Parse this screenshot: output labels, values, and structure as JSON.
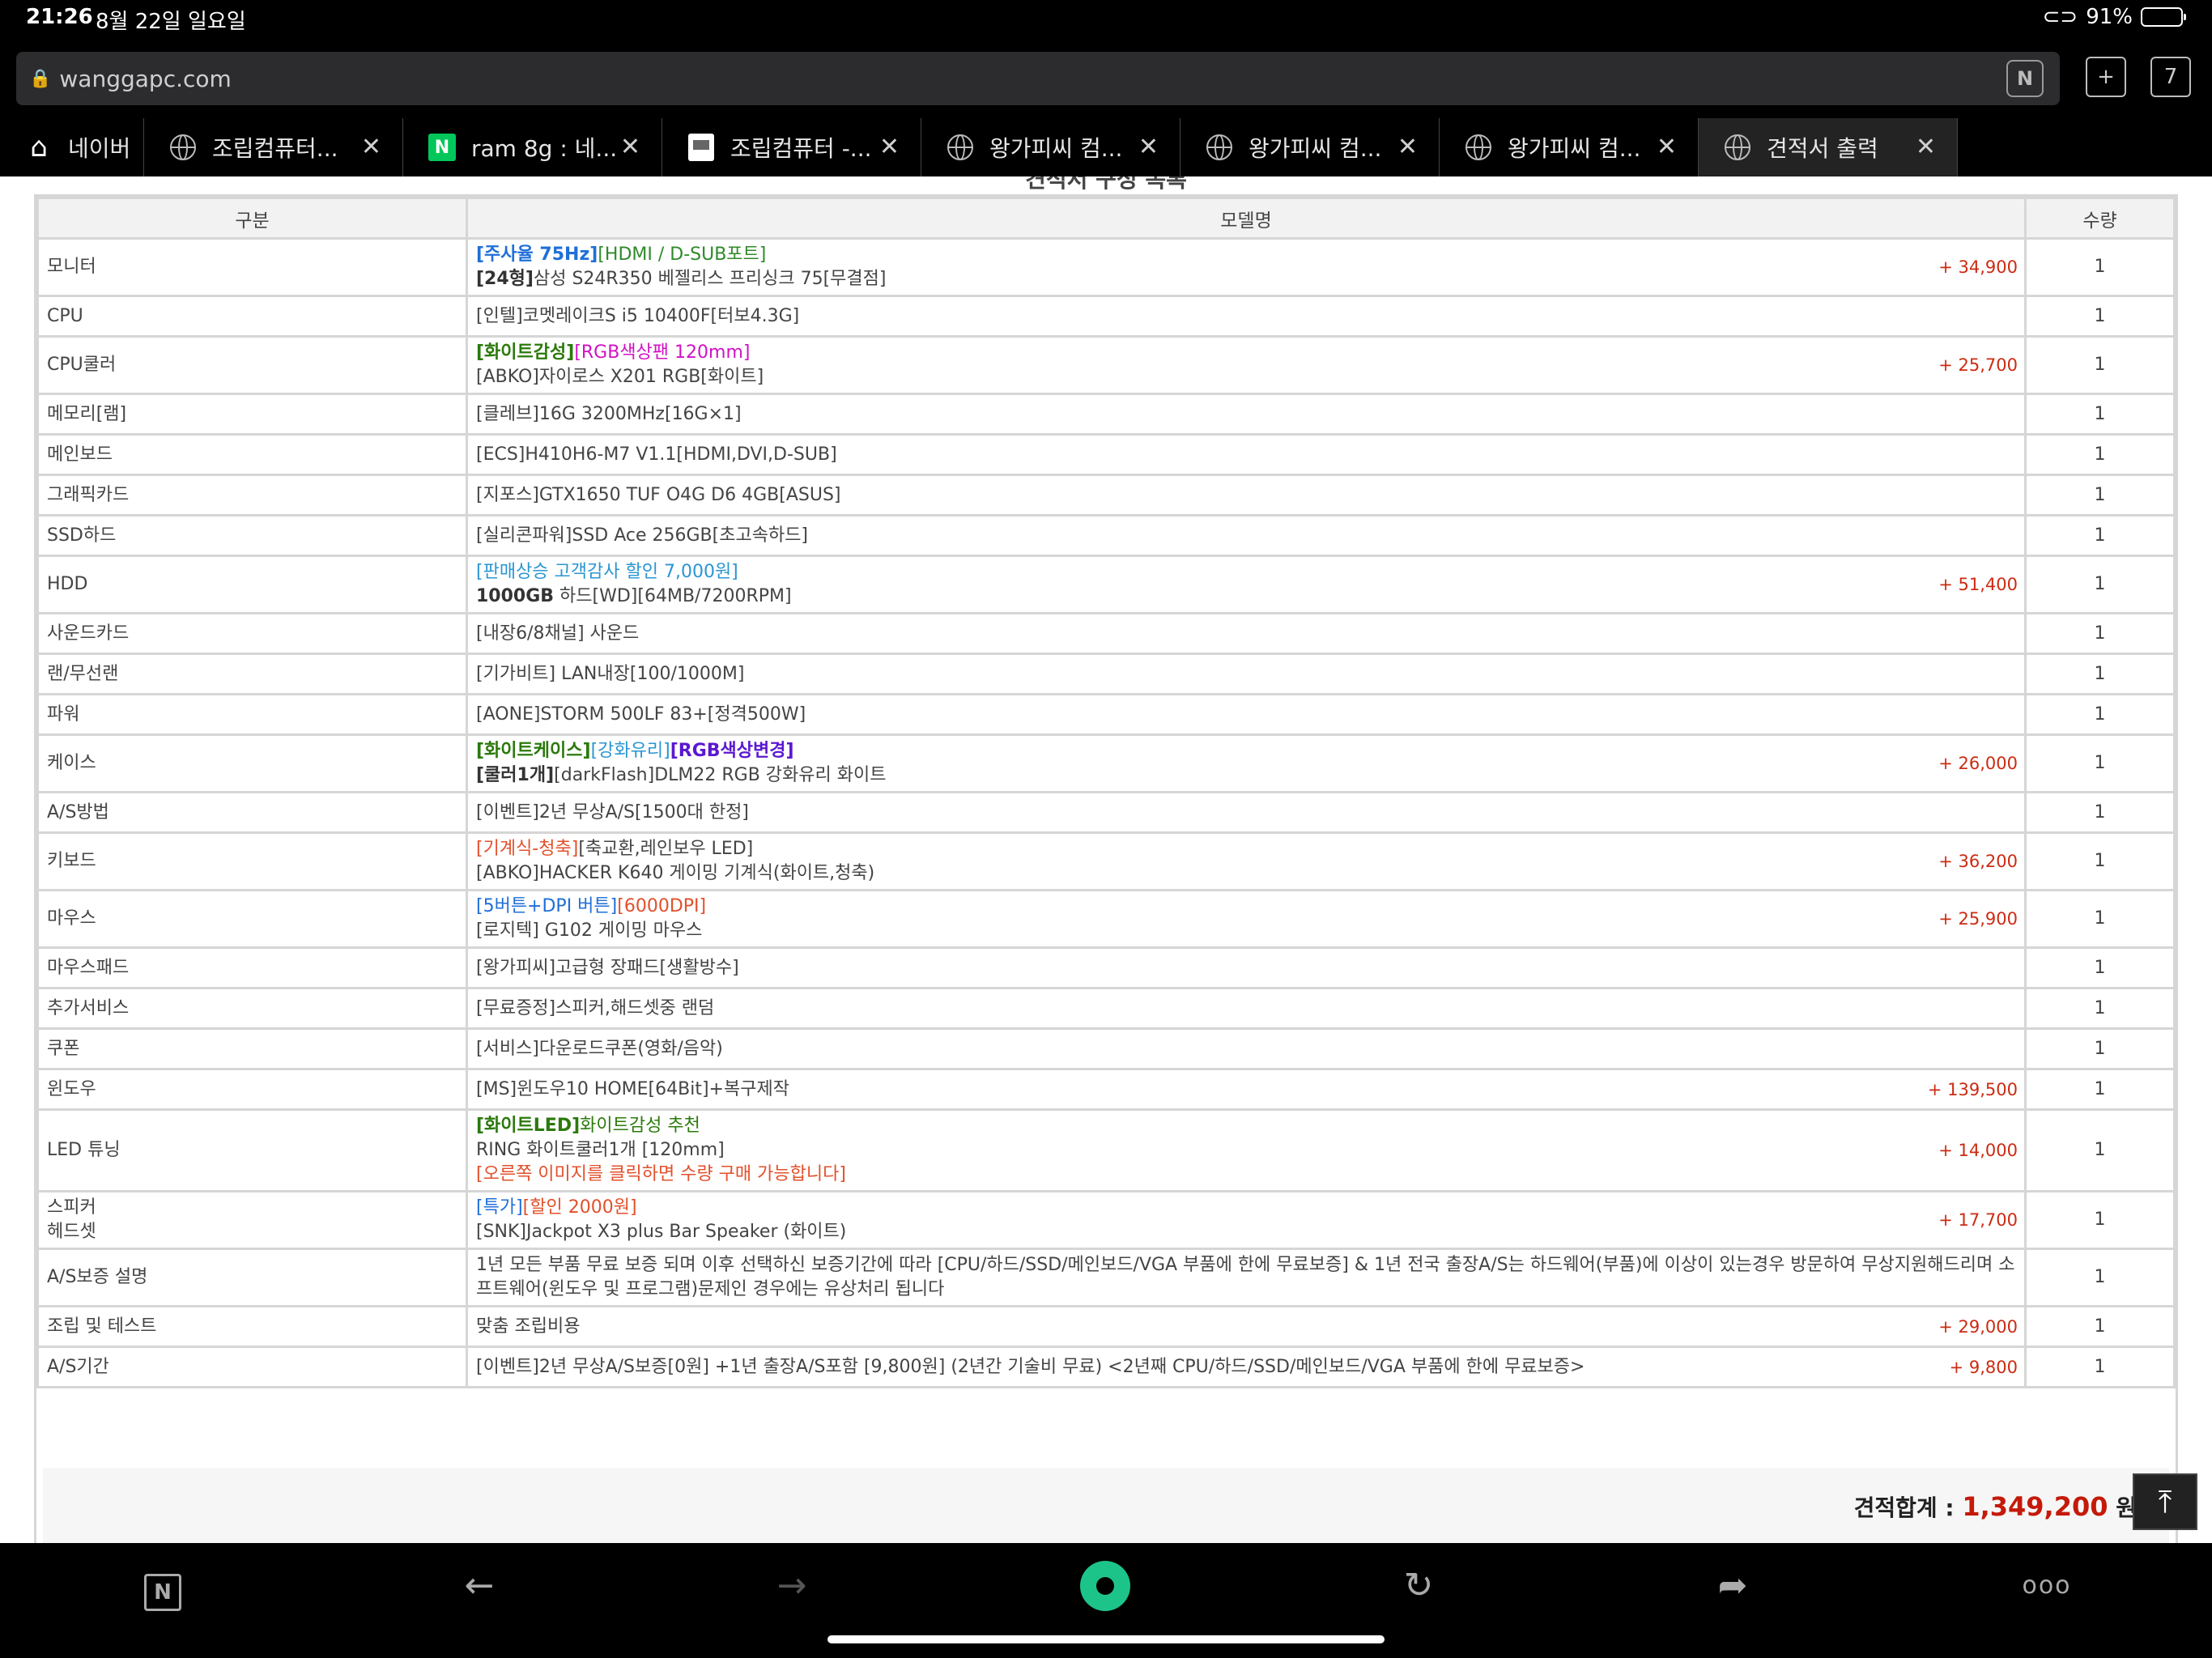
{
  "status": {
    "time": "21:26",
    "date": "8월 22일 일요일",
    "battery": "91%",
    "battery_level": 0.91
  },
  "browser": {
    "url": "wanggapc.com",
    "tab_count": "7"
  },
  "tabs": [
    {
      "label": "네이버",
      "icon": "home-icon"
    },
    {
      "label": "조립컴퓨터...",
      "icon": "globe-icon"
    },
    {
      "label": "ram 8g : 네...",
      "icon": "naver-n-icon"
    },
    {
      "label": "조립컴퓨터 -...",
      "icon": "document-icon"
    },
    {
      "label": "왕가피씨 컴...",
      "icon": "globe-icon"
    },
    {
      "label": "왕가피씨 컴...",
      "icon": "globe-icon"
    },
    {
      "label": "왕가피씨 컴...",
      "icon": "globe-icon"
    },
    {
      "label": "견적서 출력",
      "icon": "globe-icon"
    }
  ],
  "page": {
    "cut_title": "견적서 구성 목록"
  },
  "table": {
    "headers": {
      "category": "구분",
      "model": "모델명",
      "qty": "수량"
    },
    "rows": [
      {
        "cat": "모니터",
        "l1a": "[주사율 75Hz]",
        "l1b": "[HDMI / D-SUB포트]",
        "l2a": "[24형]",
        "l2b": "삼성 S24R350 베젤리스 프리싱크 75[무결점]",
        "price": "+ 34,900",
        "qty": "1"
      },
      {
        "cat": "CPU",
        "text": "[인텔]코멧레이크S i5 10400F[터보4.3G]",
        "qty": "1"
      },
      {
        "cat": "CPU쿨러",
        "l1a": "[화이트감성]",
        "l1b": "[RGB색상팬 120mm]",
        "l2": "[ABKO]자이로스 X201 RGB[화이트]",
        "price": "+ 25,700",
        "qty": "1"
      },
      {
        "cat": "메모리[램]",
        "text": "[클레브]16G 3200MHz[16G×1]",
        "qty": "1"
      },
      {
        "cat": "메인보드",
        "text": "[ECS]H410H6-M7 V1.1[HDMI,DVI,D-SUB]",
        "qty": "1"
      },
      {
        "cat": "그래픽카드",
        "text": "[지포스]GTX1650 TUF O4G D6 4GB[ASUS]",
        "qty": "1"
      },
      {
        "cat": "SSD하드",
        "text": "[실리콘파워]SSD Ace 256GB[초고속하드]",
        "qty": "1"
      },
      {
        "cat": "HDD",
        "l1": "[판매상승 고객감사 할인 7,000원]",
        "l2a": "1000GB",
        "l2b": " 하드[WD][64MB/7200RPM]",
        "price": "+ 51,400",
        "qty": "1"
      },
      {
        "cat": "사운드카드",
        "text": "[내장6/8채널] 사운드",
        "qty": "1"
      },
      {
        "cat": "랜/무선랜",
        "text": "[기가비트] LAN내장[100/1000M]",
        "qty": "1"
      },
      {
        "cat": "파워",
        "text": "[AONE]STORM 500LF 83+[정격500W]",
        "qty": "1"
      },
      {
        "cat": "케이스",
        "l1a": "[화이트케이스]",
        "l1b": "[강화유리]",
        "l1c": "[RGB색상변경]",
        "l2a": "[쿨러1개]",
        "l2b": "[darkFlash]DLM22 RGB 강화유리 화이트",
        "price": "+ 26,000",
        "qty": "1"
      },
      {
        "cat": "A/S방법",
        "text": "[이벤트]2년 무상A/S[1500대 한정]",
        "qty": "1"
      },
      {
        "cat": "키보드",
        "l1a": "[기계식-청축]",
        "l1b": "[축교환,레인보우 LED]",
        "l2": "[ABKO]HACKER K640 게이밍 기계식(화이트,청축)",
        "price": "+ 36,200",
        "qty": "1"
      },
      {
        "cat": "마우스",
        "l1a": "[5버튼+DPI 버튼]",
        "l1b": "[6000DPI]",
        "l2": "[로지텍] G102 게이밍 마우스",
        "price": "+ 25,900",
        "qty": "1"
      },
      {
        "cat": "마우스패드",
        "text": "[왕가피씨]고급형 장패드[생활방수]",
        "qty": "1"
      },
      {
        "cat": "추가서비스",
        "text": "[무료증정]스피커,해드셋중 랜덤",
        "qty": "1"
      },
      {
        "cat": "쿠폰",
        "text": "[서비스]다운로드쿠폰(영화/음악)",
        "qty": "1"
      },
      {
        "cat": "윈도우",
        "text": "[MS]윈도우10 HOME[64Bit]+복구제작",
        "price": "+ 139,500",
        "qty": "1"
      },
      {
        "cat": "LED 튜닝",
        "l1a": "[화이트LED]",
        "l1b": "화이트감성 추천",
        "l2": "RING 화이트쿨러1개 [120mm]",
        "l3": "[오른쪽 이미지를 클릭하면 수량 구매 가능합니다]",
        "price": "+ 14,000",
        "qty": "1"
      },
      {
        "cat1": "스피커",
        "cat2": "헤드셋",
        "l1a": "[특가]",
        "l1b": "[할인 2000원]",
        "l2": "[SNK]Jackpot X3 plus Bar Speaker (화이트)",
        "price": "+ 17,700",
        "qty": "1"
      },
      {
        "cat": "A/S보증 설명",
        "text": "1년 모든 부품 무료 보증 되며 이후 선택하신 보증기간에 따라 [CPU/하드/SSD/메인보드/VGA 부품에 한에 무료보증] & 1년 전국 출장A/S는 하드웨어(부품)에 이상이 있는경우 방문하여 무상지원해드리며 소프트웨어(윈도우 및 프로그램)문제인 경우에는 유상처리 됩니다",
        "qty": "1"
      },
      {
        "cat": "조립 및 테스트",
        "text": "맞춤 조립비용",
        "price": "+ 29,000",
        "qty": "1"
      },
      {
        "cat": "A/S기간",
        "text": "[이벤트]2년 무상A/S보증[0원] +1년 출장A/S포함 [9,800원] (2년간 기술비 무료) <2년째 CPU/하드/SSD/메인보드/VGA 부품에 한에 무료보증>",
        "price": "+ 9,800",
        "qty": "1"
      }
    ]
  },
  "total": {
    "label": "견적합계 : ",
    "amount": "1,349,200",
    "unit": " 원"
  },
  "colors": {
    "price": "#cc2b12",
    "total": "#c41a0a",
    "accent_green": "#1dc48a"
  }
}
